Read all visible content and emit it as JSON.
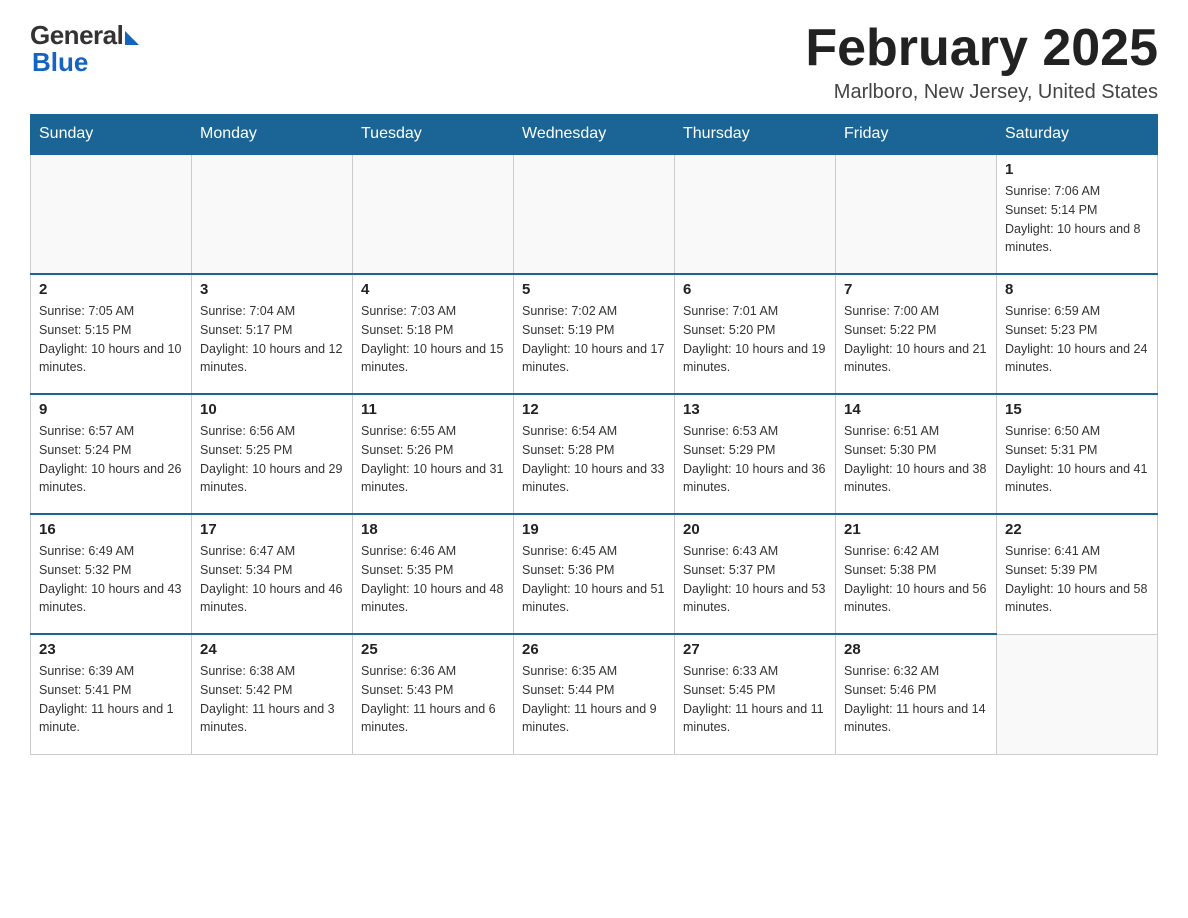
{
  "header": {
    "logo_general": "General",
    "logo_blue": "Blue",
    "month_title": "February 2025",
    "location": "Marlboro, New Jersey, United States"
  },
  "days_of_week": [
    "Sunday",
    "Monday",
    "Tuesday",
    "Wednesday",
    "Thursday",
    "Friday",
    "Saturday"
  ],
  "weeks": [
    [
      {
        "day": "",
        "info": ""
      },
      {
        "day": "",
        "info": ""
      },
      {
        "day": "",
        "info": ""
      },
      {
        "day": "",
        "info": ""
      },
      {
        "day": "",
        "info": ""
      },
      {
        "day": "",
        "info": ""
      },
      {
        "day": "1",
        "info": "Sunrise: 7:06 AM\nSunset: 5:14 PM\nDaylight: 10 hours and 8 minutes."
      }
    ],
    [
      {
        "day": "2",
        "info": "Sunrise: 7:05 AM\nSunset: 5:15 PM\nDaylight: 10 hours and 10 minutes."
      },
      {
        "day": "3",
        "info": "Sunrise: 7:04 AM\nSunset: 5:17 PM\nDaylight: 10 hours and 12 minutes."
      },
      {
        "day": "4",
        "info": "Sunrise: 7:03 AM\nSunset: 5:18 PM\nDaylight: 10 hours and 15 minutes."
      },
      {
        "day": "5",
        "info": "Sunrise: 7:02 AM\nSunset: 5:19 PM\nDaylight: 10 hours and 17 minutes."
      },
      {
        "day": "6",
        "info": "Sunrise: 7:01 AM\nSunset: 5:20 PM\nDaylight: 10 hours and 19 minutes."
      },
      {
        "day": "7",
        "info": "Sunrise: 7:00 AM\nSunset: 5:22 PM\nDaylight: 10 hours and 21 minutes."
      },
      {
        "day": "8",
        "info": "Sunrise: 6:59 AM\nSunset: 5:23 PM\nDaylight: 10 hours and 24 minutes."
      }
    ],
    [
      {
        "day": "9",
        "info": "Sunrise: 6:57 AM\nSunset: 5:24 PM\nDaylight: 10 hours and 26 minutes."
      },
      {
        "day": "10",
        "info": "Sunrise: 6:56 AM\nSunset: 5:25 PM\nDaylight: 10 hours and 29 minutes."
      },
      {
        "day": "11",
        "info": "Sunrise: 6:55 AM\nSunset: 5:26 PM\nDaylight: 10 hours and 31 minutes."
      },
      {
        "day": "12",
        "info": "Sunrise: 6:54 AM\nSunset: 5:28 PM\nDaylight: 10 hours and 33 minutes."
      },
      {
        "day": "13",
        "info": "Sunrise: 6:53 AM\nSunset: 5:29 PM\nDaylight: 10 hours and 36 minutes."
      },
      {
        "day": "14",
        "info": "Sunrise: 6:51 AM\nSunset: 5:30 PM\nDaylight: 10 hours and 38 minutes."
      },
      {
        "day": "15",
        "info": "Sunrise: 6:50 AM\nSunset: 5:31 PM\nDaylight: 10 hours and 41 minutes."
      }
    ],
    [
      {
        "day": "16",
        "info": "Sunrise: 6:49 AM\nSunset: 5:32 PM\nDaylight: 10 hours and 43 minutes."
      },
      {
        "day": "17",
        "info": "Sunrise: 6:47 AM\nSunset: 5:34 PM\nDaylight: 10 hours and 46 minutes."
      },
      {
        "day": "18",
        "info": "Sunrise: 6:46 AM\nSunset: 5:35 PM\nDaylight: 10 hours and 48 minutes."
      },
      {
        "day": "19",
        "info": "Sunrise: 6:45 AM\nSunset: 5:36 PM\nDaylight: 10 hours and 51 minutes."
      },
      {
        "day": "20",
        "info": "Sunrise: 6:43 AM\nSunset: 5:37 PM\nDaylight: 10 hours and 53 minutes."
      },
      {
        "day": "21",
        "info": "Sunrise: 6:42 AM\nSunset: 5:38 PM\nDaylight: 10 hours and 56 minutes."
      },
      {
        "day": "22",
        "info": "Sunrise: 6:41 AM\nSunset: 5:39 PM\nDaylight: 10 hours and 58 minutes."
      }
    ],
    [
      {
        "day": "23",
        "info": "Sunrise: 6:39 AM\nSunset: 5:41 PM\nDaylight: 11 hours and 1 minute."
      },
      {
        "day": "24",
        "info": "Sunrise: 6:38 AM\nSunset: 5:42 PM\nDaylight: 11 hours and 3 minutes."
      },
      {
        "day": "25",
        "info": "Sunrise: 6:36 AM\nSunset: 5:43 PM\nDaylight: 11 hours and 6 minutes."
      },
      {
        "day": "26",
        "info": "Sunrise: 6:35 AM\nSunset: 5:44 PM\nDaylight: 11 hours and 9 minutes."
      },
      {
        "day": "27",
        "info": "Sunrise: 6:33 AM\nSunset: 5:45 PM\nDaylight: 11 hours and 11 minutes."
      },
      {
        "day": "28",
        "info": "Sunrise: 6:32 AM\nSunset: 5:46 PM\nDaylight: 11 hours and 14 minutes."
      },
      {
        "day": "",
        "info": ""
      }
    ]
  ]
}
